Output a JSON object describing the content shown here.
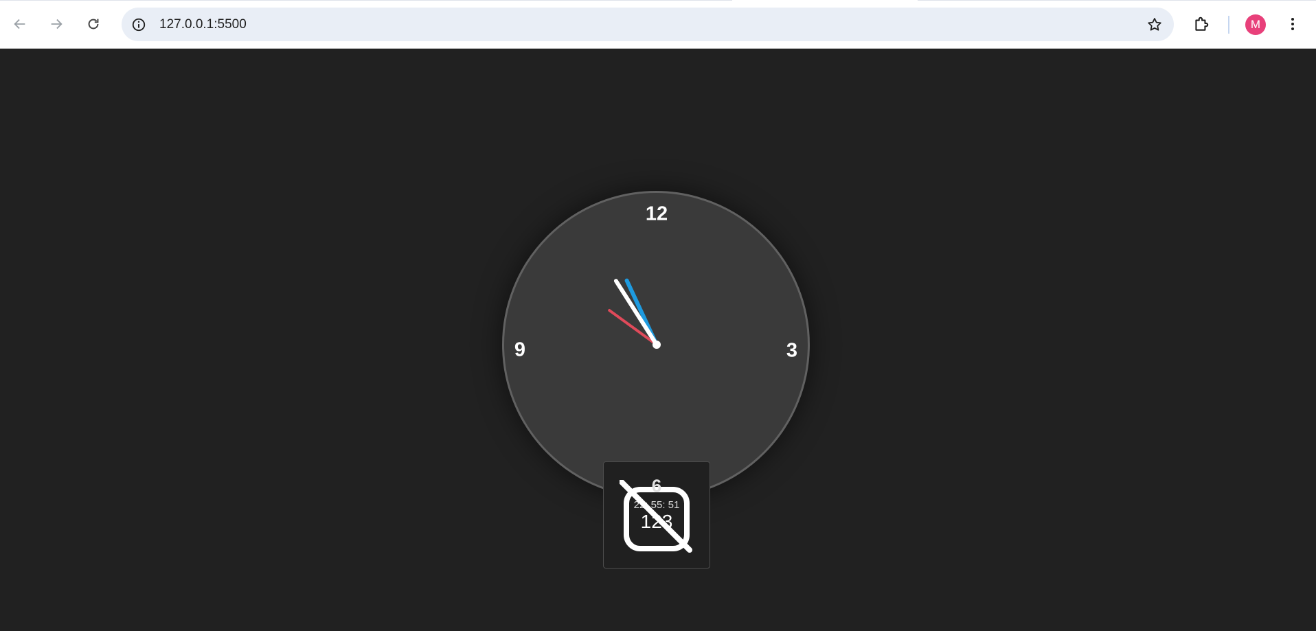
{
  "browser": {
    "url": "127.0.0.1:5500",
    "profile_initial": "M",
    "profile_color": "#e8407a",
    "icons": {
      "back": "arrow-left-icon",
      "forward": "arrow-right-icon",
      "reload": "reload-icon",
      "site_info": "info-icon",
      "bookmark": "star-icon",
      "extensions": "puzzle-icon",
      "menu": "kebab-menu-icon"
    }
  },
  "clock": {
    "face_color": "#3a3a3a",
    "numerals": {
      "twelve": "12",
      "three": "3",
      "six": "6",
      "nine": "9"
    },
    "time": {
      "hours": 22,
      "minutes": 55,
      "seconds": 51
    },
    "hand_colors": {
      "hour": "#ffffff",
      "minute": "#1e9be0",
      "second": "#e04a5a"
    }
  },
  "digital": {
    "time_text": "22: 55: 51",
    "icon": "calendar-123-off-icon"
  }
}
